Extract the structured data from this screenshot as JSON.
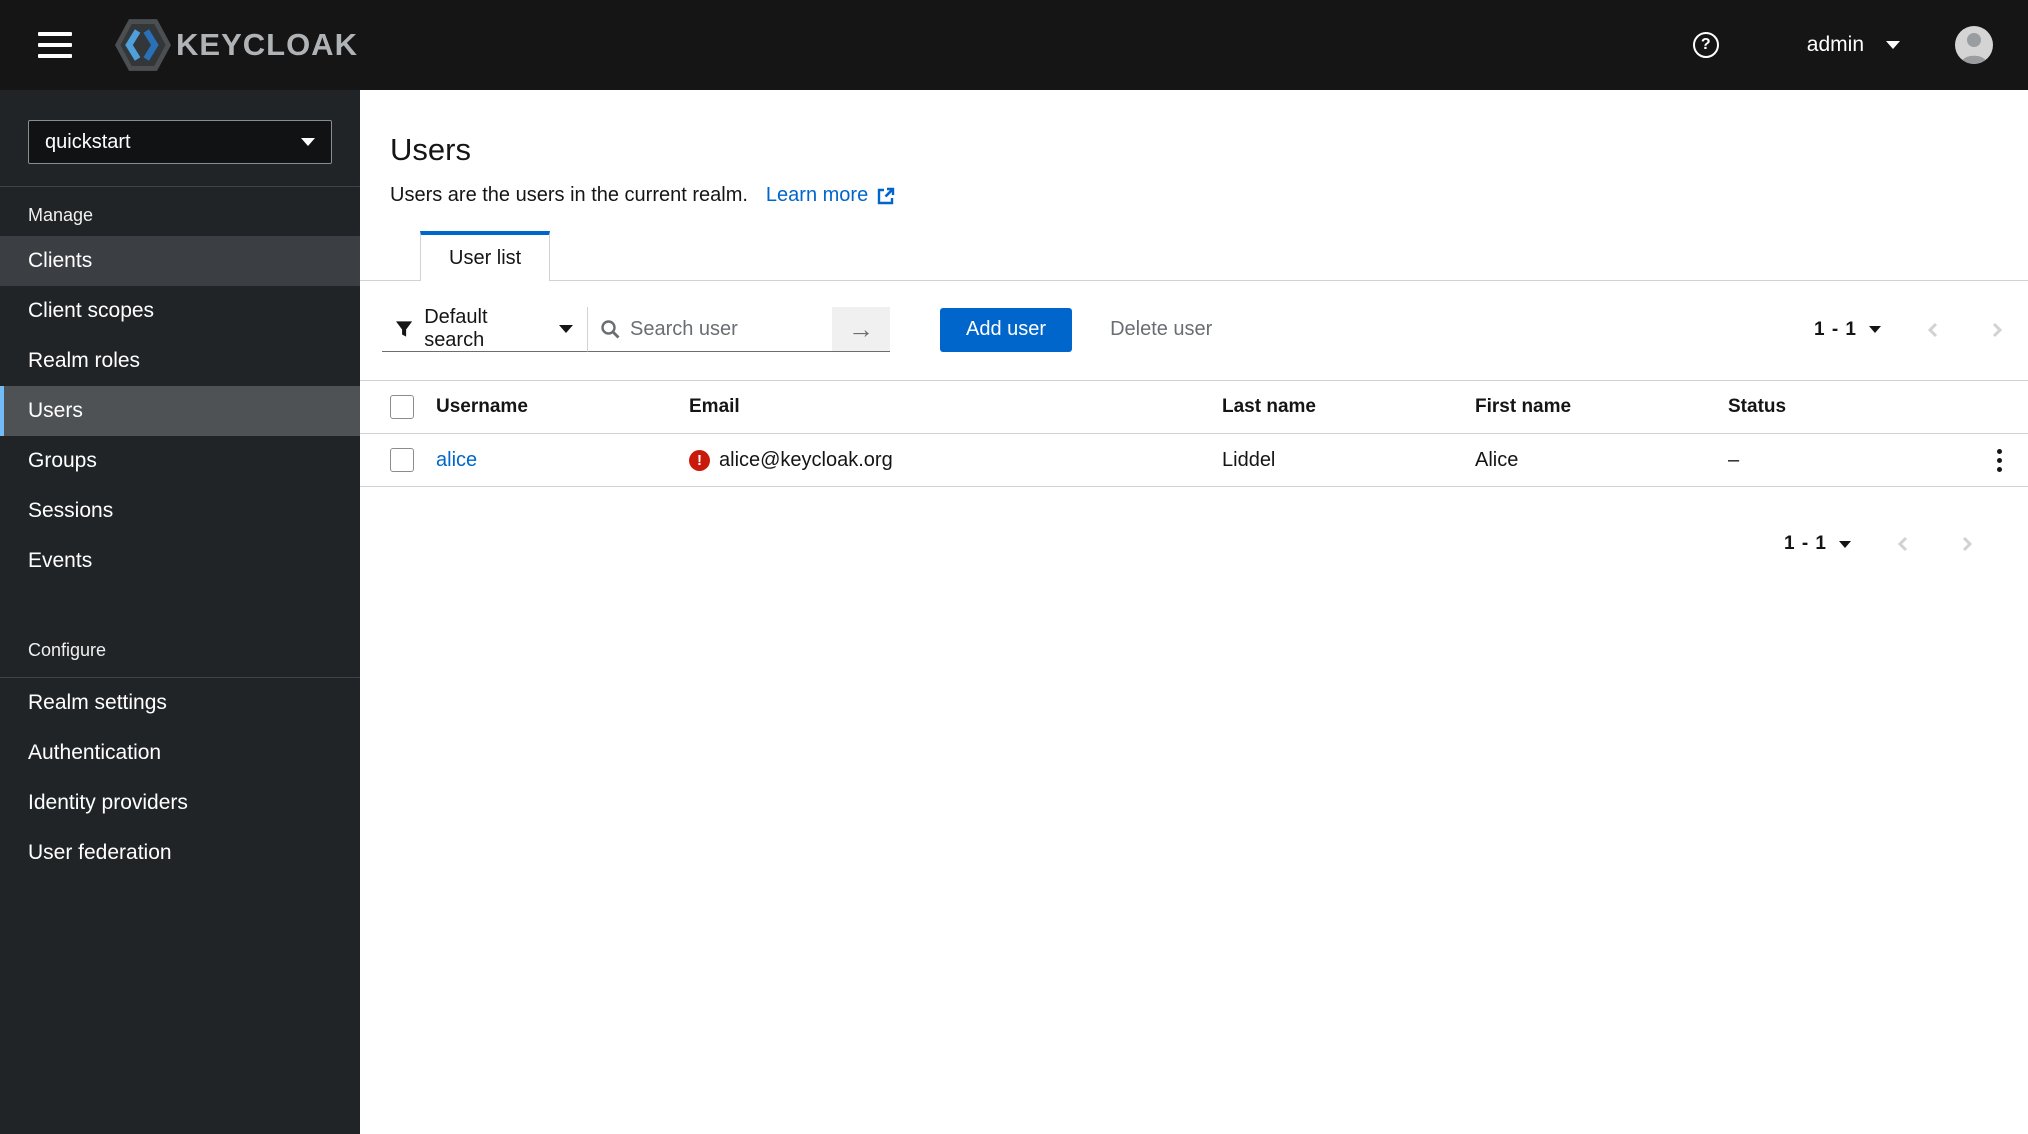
{
  "masthead": {
    "brand": "KEYCLOAK",
    "username": "admin",
    "help_glyph": "?"
  },
  "sidebar": {
    "realm": "quickstart",
    "sections": [
      {
        "label": "Manage",
        "items": [
          {
            "label": "Clients",
            "state": "hover"
          },
          {
            "label": "Client scopes",
            "state": ""
          },
          {
            "label": "Realm roles",
            "state": ""
          },
          {
            "label": "Users",
            "state": "selected"
          },
          {
            "label": "Groups",
            "state": ""
          },
          {
            "label": "Sessions",
            "state": ""
          },
          {
            "label": "Events",
            "state": ""
          }
        ]
      },
      {
        "label": "Configure",
        "items": [
          {
            "label": "Realm settings",
            "state": ""
          },
          {
            "label": "Authentication",
            "state": ""
          },
          {
            "label": "Identity providers",
            "state": ""
          },
          {
            "label": "User federation",
            "state": ""
          }
        ]
      }
    ]
  },
  "page": {
    "title": "Users",
    "subtitle": "Users are the users in the current realm.",
    "learn_more_label": "Learn more",
    "tabs": [
      {
        "label": "User list",
        "active": true
      }
    ]
  },
  "toolbar": {
    "filter_label": "Default search",
    "search_placeholder": "Search user",
    "search_value": "",
    "arrow_glyph": "→",
    "add_user_label": "Add user",
    "delete_user_label": "Delete user"
  },
  "pagination": {
    "top": "1 - 1",
    "bottom": "1 - 1"
  },
  "table": {
    "columns": [
      "Username",
      "Email",
      "Last name",
      "First name",
      "Status"
    ],
    "rows": [
      {
        "username": "alice",
        "email": "alice@keycloak.org",
        "email_warning": true,
        "warning_glyph": "!",
        "last_name": "Liddel",
        "first_name": "Alice",
        "status": "–"
      }
    ],
    "kebab_glyph": "⋮"
  },
  "colors": {
    "accent": "#0066cc",
    "link": "#0066cc",
    "danger": "#c9190b",
    "nav_selected_border": "#73bcf7",
    "masthead_bg": "#151515",
    "sidebar_bg": "#212427"
  }
}
